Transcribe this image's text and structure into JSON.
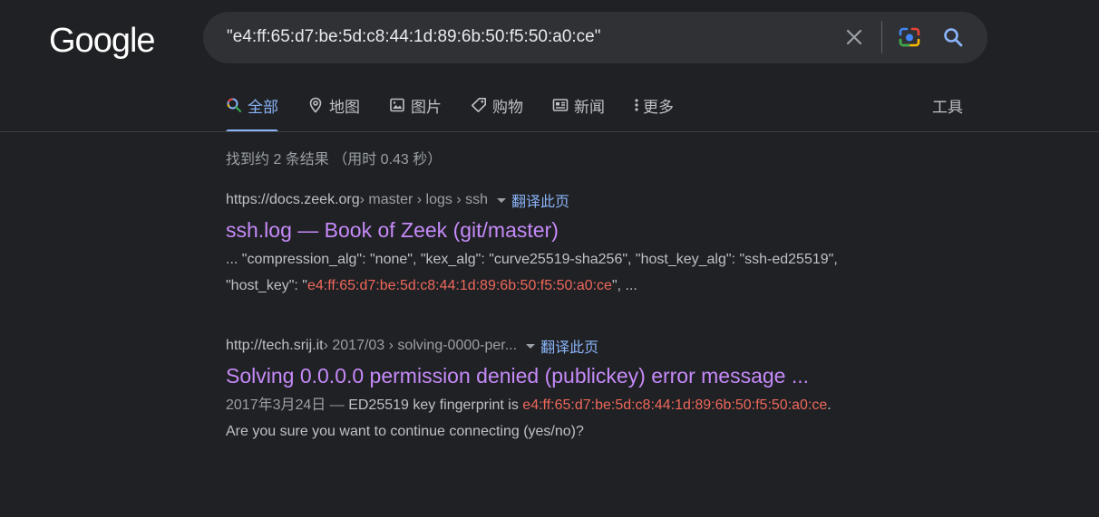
{
  "logo": "Google",
  "search": {
    "query": "\"e4:ff:65:d7:be:5d:c8:44:1d:89:6b:50:f5:50:a0:ce\""
  },
  "tabs": [
    {
      "label": "全部",
      "icon": "search-icon"
    },
    {
      "label": "地图",
      "icon": "map-pin-icon"
    },
    {
      "label": "图片",
      "icon": "image-icon"
    },
    {
      "label": "购物",
      "icon": "tag-icon"
    },
    {
      "label": "新闻",
      "icon": "newspaper-icon"
    },
    {
      "label": "更多",
      "icon": "more-vert-icon"
    }
  ],
  "tools_label": "工具",
  "stats": "找到约 2 条结果 （用时 0.43 秒）",
  "results": [
    {
      "domain": "https://docs.zeek.org",
      "path": " › master › logs › ssh",
      "translate": "翻译此页",
      "title": "ssh.log — Book of Zeek (git/master)",
      "snippet_line1": "... \"compression_alg\": \"none\", \"kex_alg\": \"curve25519-sha256\", \"host_key_alg\": \"ssh-ed25519\",",
      "snippet_pre": "\"host_key\": \"",
      "snippet_hl": "e4:ff:65:d7:be:5d:c8:44:1d:89:6b:50:f5:50:a0:ce",
      "snippet_post": "\", ..."
    },
    {
      "domain": "http://tech.srij.it",
      "path": " › 2017/03 › solving-0000-per...",
      "translate": "翻译此页",
      "title": "Solving 0.0.0.0 permission denied (publickey) error message ...",
      "date": "2017年3月24日 — ",
      "snippet_pre": "ED25519 key fingerprint is ",
      "snippet_hl": "e4:ff:65:d7:be:5d:c8:44:1d:89:6b:50:f5:50:a0:ce",
      "snippet_post": ".",
      "snippet_line2": "Are you sure you want to continue connecting (yes/no)?"
    }
  ],
  "colors": {
    "background": "#202124",
    "link_visited": "#c58af9",
    "accent": "#8ab4f8",
    "highlight": "#ee675c"
  }
}
